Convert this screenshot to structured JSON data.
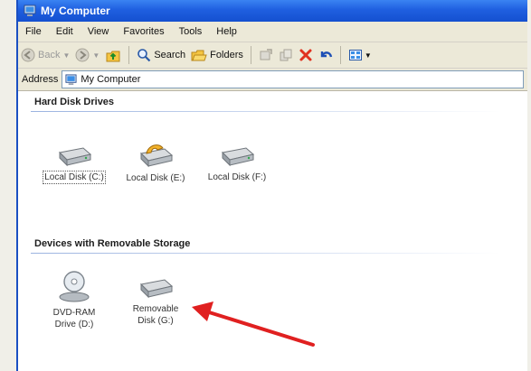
{
  "window": {
    "title": "My Computer"
  },
  "menubar": {
    "items": [
      "File",
      "Edit",
      "View",
      "Favorites",
      "Tools",
      "Help"
    ]
  },
  "toolbar": {
    "back_label": "Back",
    "search_label": "Search",
    "folders_label": "Folders"
  },
  "addressbar": {
    "label": "Address",
    "value": "My Computer"
  },
  "hard_disk_drives": {
    "title": "Hard Disk Drives",
    "items": [
      "Local Disk (C:)",
      "Local Disk (E:)",
      "Local Disk (F:)"
    ]
  },
  "removable_storage": {
    "title": "Devices with Removable Storage",
    "items": [
      {
        "line1": "DVD-RAM",
        "line2": "Drive (D:)"
      },
      {
        "line1": "Removable",
        "line2": "Disk (G:)"
      }
    ]
  },
  "colors": {
    "titlebar": "#1f5fe0",
    "arrow": "#e02020",
    "chrome": "#ece9d8"
  }
}
